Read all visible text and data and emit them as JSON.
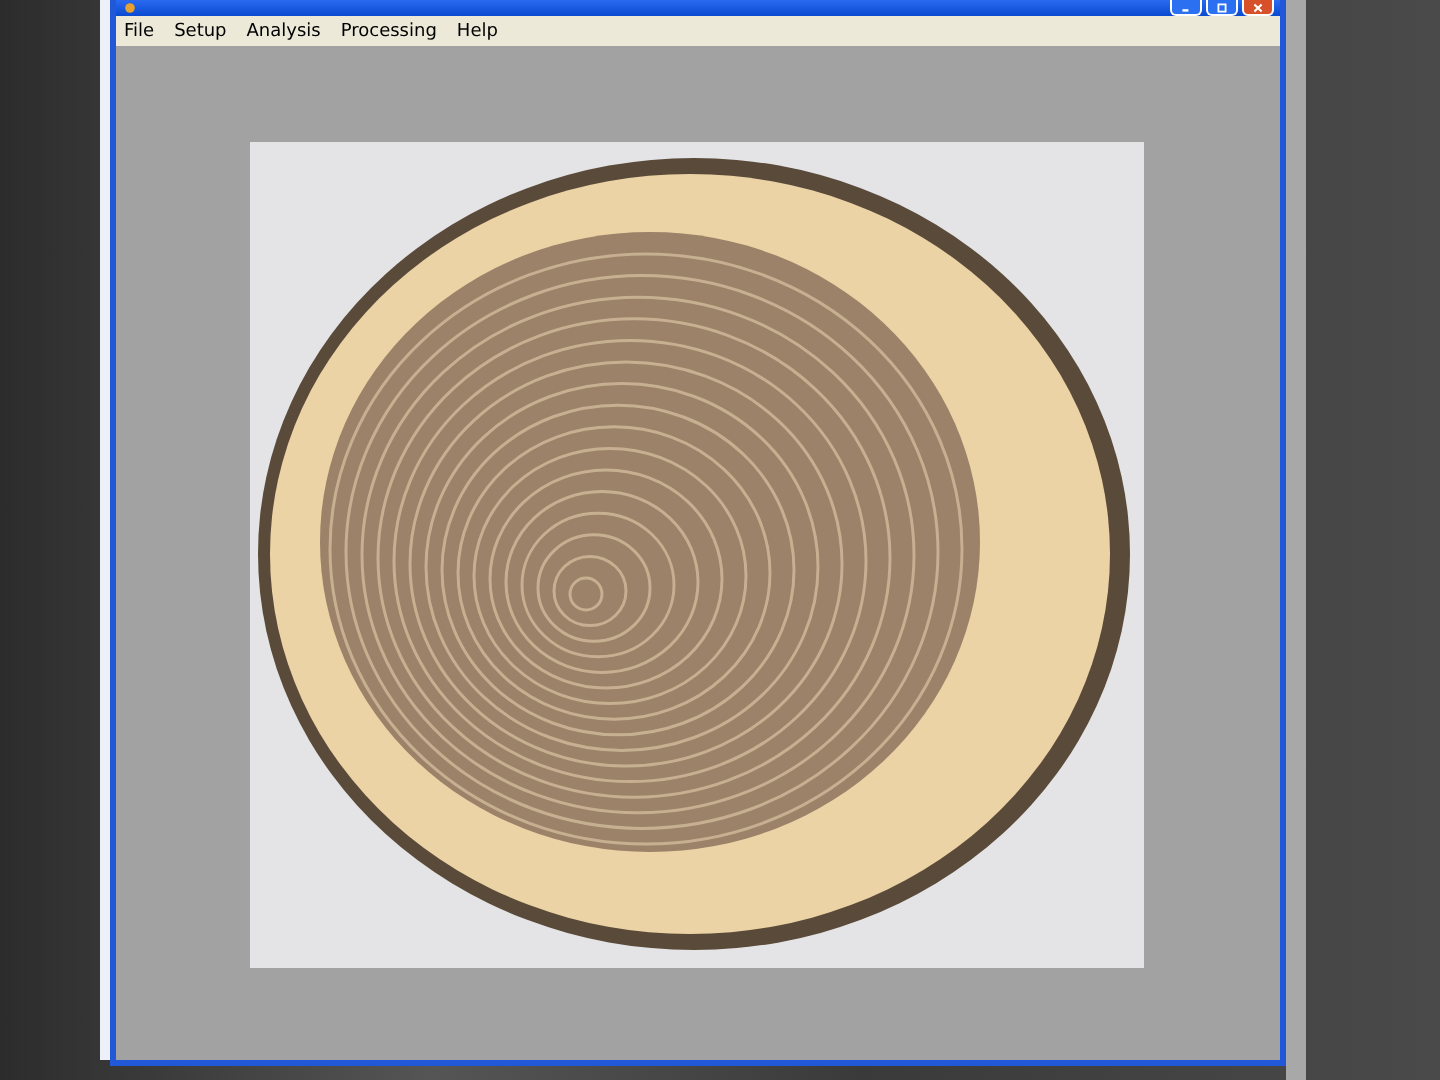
{
  "menu_bar": {
    "items": [
      {
        "label": "File"
      },
      {
        "label": "Setup"
      },
      {
        "label": "Analysis"
      },
      {
        "label": "Processing"
      },
      {
        "label": "Help"
      }
    ]
  }
}
